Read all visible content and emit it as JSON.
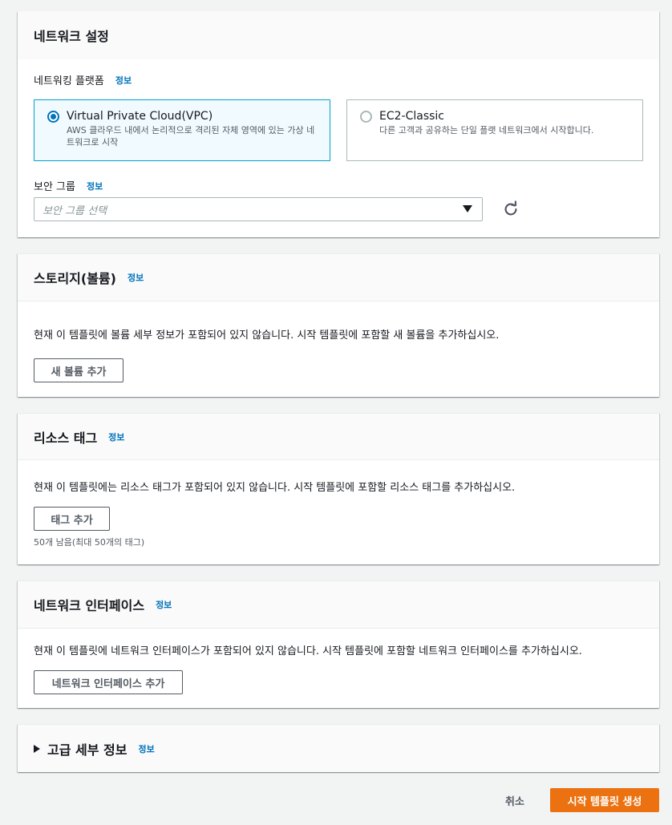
{
  "network": {
    "title": "네트워크 설정",
    "platform_label": "네트워킹 플랫폼",
    "info": "정보",
    "tiles": [
      {
        "title": "Virtual Private Cloud(VPC)",
        "desc": "AWS 클라우드 내에서 논리적으로 격리된 자체 영역에 있는 가상 네트워크로 시작",
        "selected": true
      },
      {
        "title": "EC2-Classic",
        "desc": "다른 고객과 공유하는 단일 플랫 네트워크에서 시작합니다.",
        "selected": false
      }
    ],
    "sg_label": "보안 그룹",
    "sg_placeholder": "보안 그룹 선택"
  },
  "storage": {
    "title": "스토리지(볼륨)",
    "info": "정보",
    "desc": "현재 이 템플릿에 볼륨 세부 정보가 포함되어 있지 않습니다. 시작 템플릿에 포함할 새 볼륨을 추가하십시오.",
    "button": "새 볼륨 추가"
  },
  "tags": {
    "title": "리소스 태그",
    "info": "정보",
    "desc": "현재 이 템플릿에는 리소스 태그가 포함되어 있지 않습니다. 시작 템플릿에 포함할 리소스 태그를 추가하십시오.",
    "button": "태그 추가",
    "remaining": "50개 남음(최대 50개의 태그)"
  },
  "network_interfaces": {
    "title": "네트워크 인터페이스",
    "info": "정보",
    "desc": "현재 이 템플릿에 네트워크 인터페이스가 포함되어 있지 않습니다. 시작 템플릿에 포함할 네트워크 인터페이스를 추가하십시오.",
    "button": "네트워크 인터페이스 추가"
  },
  "advanced": {
    "title": "고급 세부 정보",
    "info": "정보"
  },
  "footer": {
    "cancel": "취소",
    "create": "시작 템플릿 생성"
  },
  "colors": {
    "primary": "#ec7211",
    "link": "#0073bb",
    "selected_bg": "#f1faff",
    "selected_border": "#00a1c9"
  }
}
